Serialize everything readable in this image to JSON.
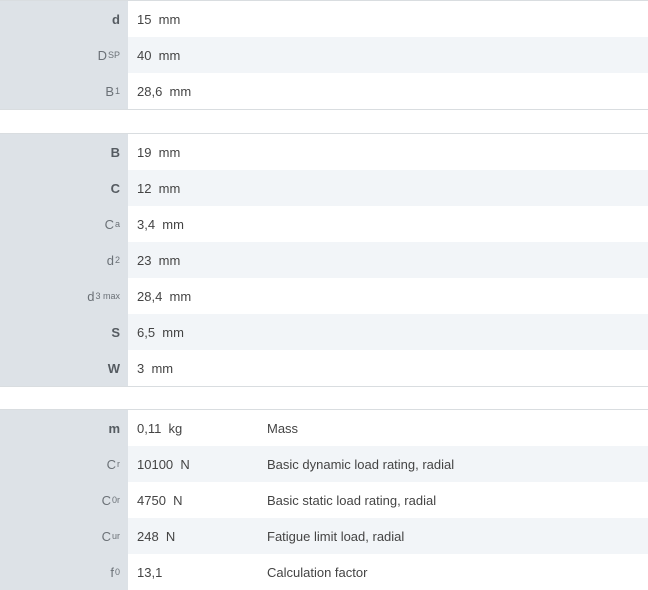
{
  "group1": [
    {
      "sym": "d",
      "sub": "",
      "value": "15  mm",
      "desc": ""
    },
    {
      "sym": "D",
      "sub": "SP",
      "value": "40  mm",
      "desc": ""
    },
    {
      "sym": "B",
      "sub": "1",
      "value": "28,6  mm",
      "desc": ""
    }
  ],
  "group2": [
    {
      "sym": "B",
      "sub": "",
      "value": "19  mm",
      "desc": ""
    },
    {
      "sym": "C",
      "sub": "",
      "value": "12  mm",
      "desc": ""
    },
    {
      "sym": "C",
      "sub": "a",
      "value": "3,4  mm",
      "desc": ""
    },
    {
      "sym": "d",
      "sub": "2",
      "value": "23  mm",
      "desc": ""
    },
    {
      "sym": "d",
      "sub": "3 max",
      "value": "28,4  mm",
      "desc": ""
    },
    {
      "sym": "S",
      "sub": "",
      "value": "6,5  mm",
      "desc": ""
    },
    {
      "sym": "W",
      "sub": "",
      "value": "3  mm",
      "desc": ""
    }
  ],
  "group3": [
    {
      "sym": "m",
      "sub": "",
      "value": "0,11  kg",
      "desc": "Mass"
    },
    {
      "sym": "C",
      "sub": "r",
      "value": "10100  N",
      "desc": "Basic dynamic load rating, radial"
    },
    {
      "sym": "C",
      "sub": "0r",
      "value": "4750  N",
      "desc": "Basic static load rating, radial"
    },
    {
      "sym": "C",
      "sub": "ur",
      "value": "248  N",
      "desc": "Fatigue limit load, radial"
    },
    {
      "sym": "f",
      "sub": "0",
      "value": "13,1",
      "desc": "Calculation factor"
    }
  ]
}
